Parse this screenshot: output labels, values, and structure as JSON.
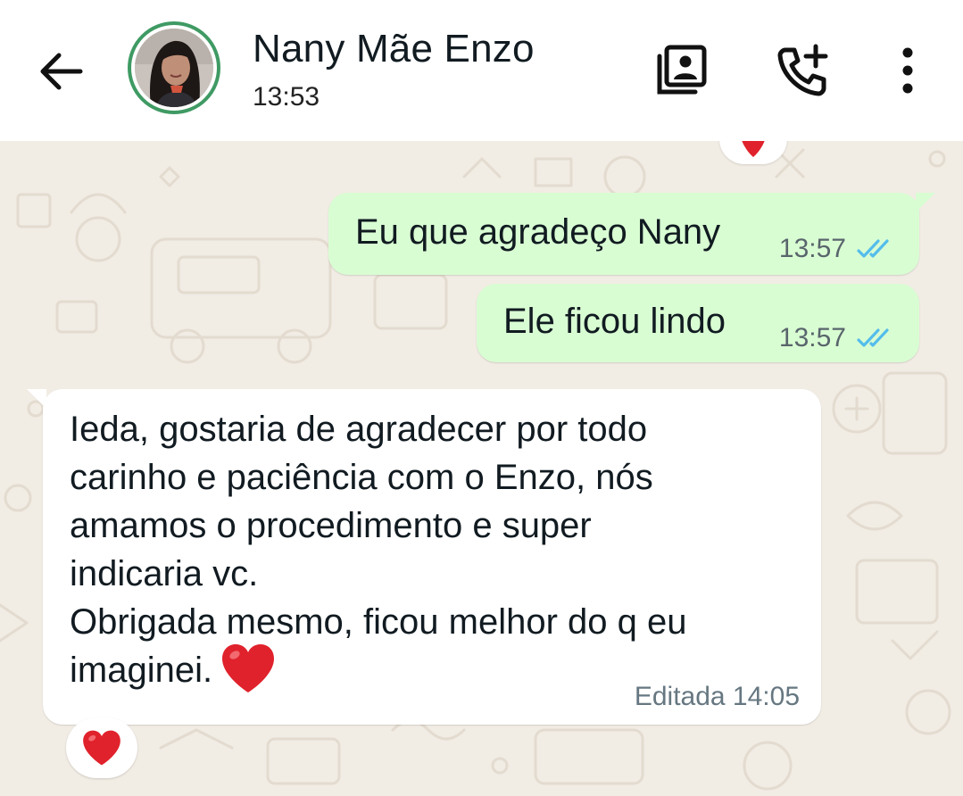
{
  "header": {
    "contact_name": "Nany Mãe Enzo",
    "last_seen": "13:53",
    "icons": {
      "back": "arrow-left-icon",
      "media": "contact-gallery-icon",
      "call": "add-call-icon",
      "menu": "more-vert-icon"
    }
  },
  "messages": [
    {
      "direction": "outgoing",
      "text": "Eu que agradeço Nany",
      "time": "13:57",
      "status": "read"
    },
    {
      "direction": "outgoing",
      "text": "Ele ficou lindo",
      "time": "13:57",
      "status": "read"
    },
    {
      "direction": "incoming",
      "lines": [
        "Ieda, gostaria de agradecer por todo",
        "carinho e paciência com o Enzo, nós",
        "amamos o procedimento e super",
        "indicaria vc.",
        "Obrigada mesmo, ficou melhor do q eu",
        "imaginei."
      ],
      "edited_label": "Editada 14:05",
      "reaction": "❤️"
    }
  ],
  "colors": {
    "outgoing_bubble": "#d9fdd3",
    "incoming_bubble": "#ffffff",
    "wallpaper": "#f1ece4",
    "read_ticks": "#53bdeb",
    "avatar_ring": "#3f9a63",
    "heart": "#e0222c"
  }
}
